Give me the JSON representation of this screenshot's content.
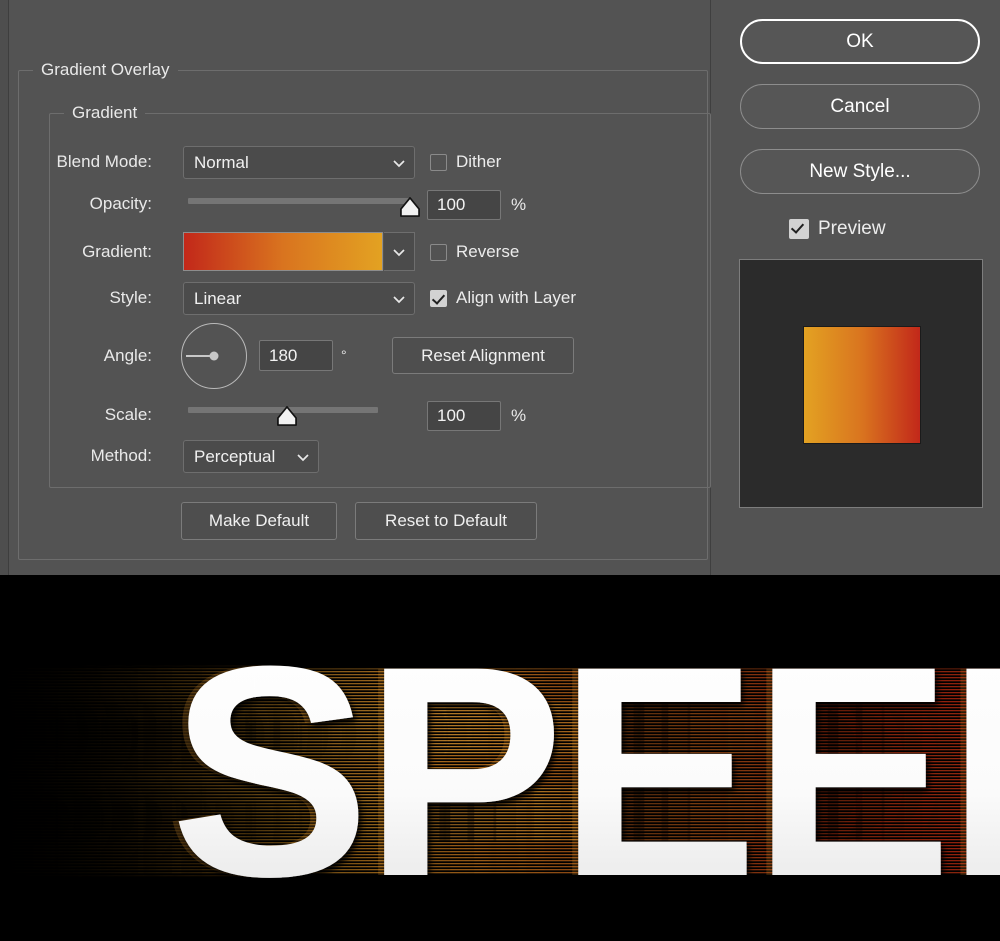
{
  "dialog": {
    "title": "Gradient Overlay",
    "groups": {
      "outer_legend": "Gradient Overlay",
      "inner_legend": "Gradient"
    },
    "fields": {
      "blend_mode": {
        "label": "Blend Mode:",
        "value": "Normal"
      },
      "opacity": {
        "label": "Opacity:",
        "value": "100",
        "unit": "%",
        "percent": 100
      },
      "gradient": {
        "label": "Gradient:"
      },
      "style": {
        "label": "Style:",
        "value": "Linear"
      },
      "angle": {
        "label": "Angle:",
        "value": "180",
        "unit": "°",
        "degrees": 180
      },
      "scale": {
        "label": "Scale:",
        "value": "100",
        "unit": "%",
        "percent": 52
      },
      "method": {
        "label": "Method:",
        "value": "Perceptual"
      }
    },
    "checkboxes": {
      "dither": {
        "label": "Dither",
        "checked": false
      },
      "reverse": {
        "label": "Reverse",
        "checked": false
      },
      "align": {
        "label": "Align with Layer",
        "checked": true
      },
      "preview": {
        "label": "Preview",
        "checked": true
      }
    },
    "buttons": {
      "reset_alignment": "Reset Alignment",
      "make_default": "Make Default",
      "reset_to_default": "Reset to Default",
      "ok": "OK",
      "cancel": "Cancel",
      "new_style": "New Style..."
    },
    "icons": {
      "chevron_down": "chevron-down-icon",
      "checkmark": "check-icon"
    }
  },
  "colors": {
    "panel_bg": "#535353",
    "field_bg": "#454545",
    "select_bg": "#4b4b4b",
    "border": "#6d6d6d",
    "text": "#e9e9e9",
    "preview_bg": "#2b2b2b",
    "gradient_start": "#c2281a",
    "gradient_mid": "#d9641f",
    "gradient_end": "#e3a222",
    "artwork_bg": "#000000",
    "artwork_text": "#ffffff"
  },
  "gradient_swatch": {
    "stops": [
      {
        "offset": 0,
        "color": "#c2281a"
      },
      {
        "offset": 0.5,
        "color": "#d9741f"
      },
      {
        "offset": 1.0,
        "color": "#e3a222"
      }
    ],
    "direction": "left-to-right"
  },
  "preview_swatch": {
    "stops": [
      {
        "offset": 0,
        "color": "#e3a222"
      },
      {
        "offset": 0.5,
        "color": "#d9741f"
      },
      {
        "offset": 1.0,
        "color": "#c2281a"
      }
    ],
    "direction": "left-to-right (reversed, angle 180)"
  },
  "artwork": {
    "word": "SPEED",
    "background": "#000000",
    "letter_fill": "#ffffff",
    "effect": "horizontal motion-blur streaks, warm orange/red gradient"
  }
}
